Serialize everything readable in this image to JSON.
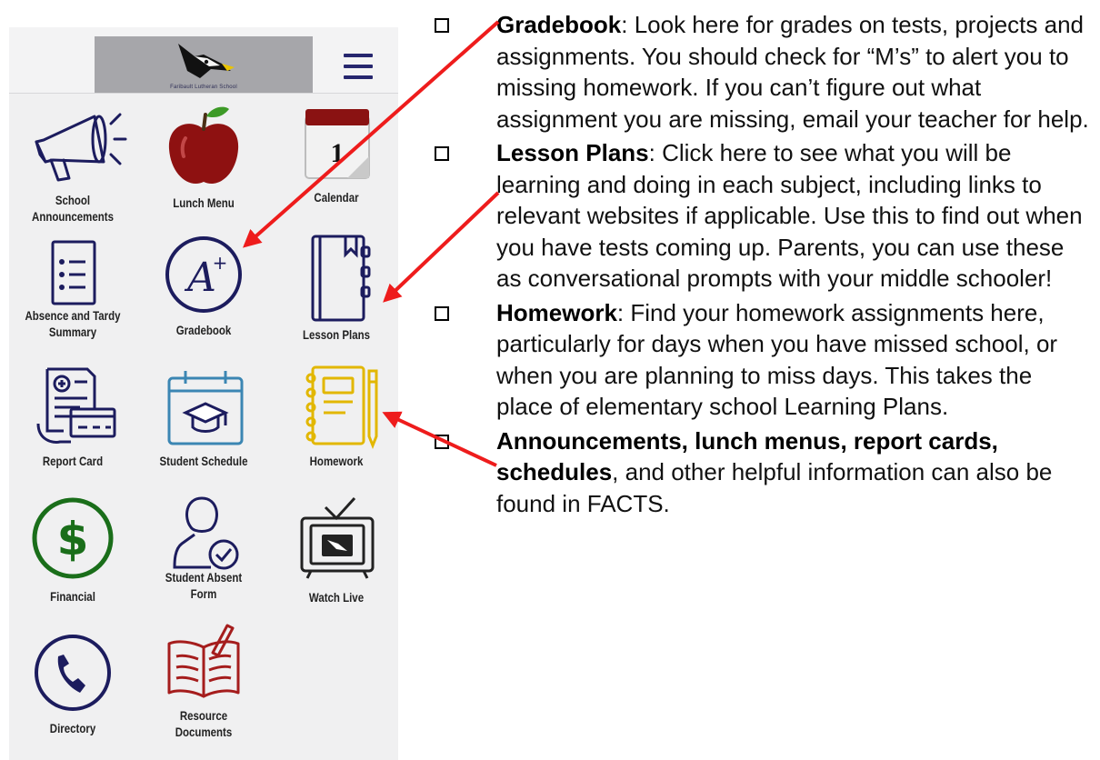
{
  "app": {
    "logo_caption": "Faribault Lutheran School",
    "menu_icon": "hamburger-menu-icon"
  },
  "tiles": [
    {
      "label": "School Announcements",
      "icon": "megaphone-icon"
    },
    {
      "label": "Lunch Menu",
      "icon": "apple-icon"
    },
    {
      "label": "Calendar",
      "icon": "calendar-icon",
      "day_number": "1"
    },
    {
      "label": "Absence and Tardy Summary",
      "icon": "checklist-icon"
    },
    {
      "label": "Gradebook",
      "icon": "grade-a-plus-icon"
    },
    {
      "label": "Lesson Plans",
      "icon": "notebook-icon"
    },
    {
      "label": "Report Card",
      "icon": "report-card-icon"
    },
    {
      "label": "Student Schedule",
      "icon": "schedule-graduation-icon"
    },
    {
      "label": "Homework",
      "icon": "homework-notebook-icon"
    },
    {
      "label": "Financial",
      "icon": "dollar-icon"
    },
    {
      "label": "Student Absent Form",
      "icon": "student-check-icon"
    },
    {
      "label": "Watch Live",
      "icon": "television-icon"
    },
    {
      "label": "Directory",
      "icon": "phone-icon"
    },
    {
      "label": "Resource Documents",
      "icon": "open-book-icon"
    }
  ],
  "instructions": [
    {
      "title": "Gradebook",
      "text": ": Look here for grades on tests, projects and assignments.  You should check for “M’s” to alert you to missing homework. If you can’t figure out what assignment you are missing, email your teacher for help."
    },
    {
      "title": "Lesson Plans",
      "text": ": Click here to see what you will be learning and doing in each subject, including links to relevant websites if applicable.  Use this to find out when you have tests coming up.   Parents, you can use these as conversational prompts with your middle schooler!"
    },
    {
      "title": "Homework",
      "text": ": Find your homework assignments here, particularly for days when you have missed school, or when you are planning to miss days.  This takes the place of elementary school Learning Plans."
    },
    {
      "title": "Announcements, lunch menus, report cards, schedules",
      "text": ", and other helpful information can also be found in FACTS."
    }
  ],
  "colors": {
    "arrow": "#ee1c1c",
    "navy": "#1c1c5e",
    "apple_red": "#8e1111",
    "financial_green": "#1a6e1a",
    "homework_yellow": "#e2b700",
    "schedule_blue": "#3b86b3",
    "book_red": "#a51d1d"
  }
}
